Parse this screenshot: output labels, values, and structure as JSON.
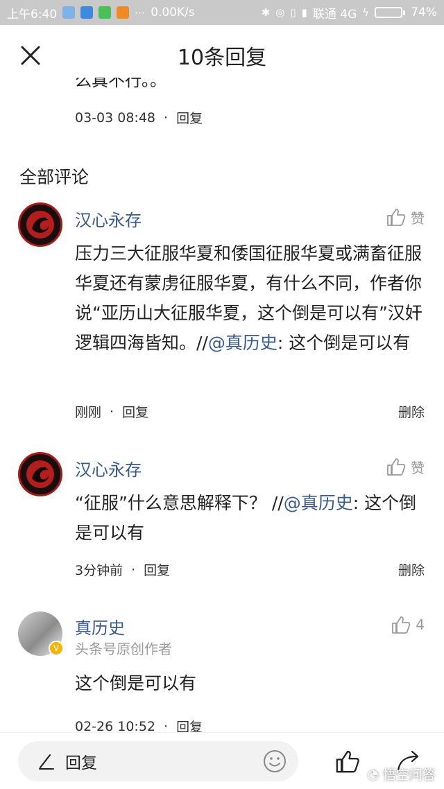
{
  "status_bar": {
    "time": "上午6:40",
    "network_speed": "0.00K/s",
    "carrier": "联通 4G",
    "battery": "74%",
    "battery_level": 0.74
  },
  "header": {
    "title": "10条回复"
  },
  "previous_reply": {
    "clipped_text": "么真不行。。",
    "time": "03-03 08:48",
    "reply_label": "回复"
  },
  "section": {
    "title": "全部评论"
  },
  "comments": [
    {
      "user": "汉心永存",
      "like_label": "赞",
      "text_before_mention": "压力三大征服华夏和倭国征服华夏或满畜征服华夏还有蒙虏征服华夏，有什么不同，作者你说“亚历山大征服华夏，这个倒是可以有”汉奸逻辑四海皆知。//",
      "mention": "@真历史",
      "text_after_mention": ": 这个倒是可以有",
      "time": "刚刚",
      "reply_label": "回复",
      "delete_label": "删除"
    },
    {
      "user": "汉心永存",
      "like_label": "赞",
      "text_before_mention": "“征服”什么意思解释下？ //",
      "mention": "@真历史",
      "text_after_mention": ": 这个倒是可以有",
      "time": "3分钟前",
      "reply_label": "回复",
      "delete_label": "删除"
    },
    {
      "user": "真历史",
      "subtitle": "头条号原创作者",
      "like_count": "4",
      "text": "这个倒是可以有",
      "time": "02-26 10:52",
      "reply_label": "回复"
    }
  ],
  "bottom_bar": {
    "reply_label": "回复"
  },
  "watermark": {
    "text": "悟空问答"
  },
  "colors": {
    "link": "#3a5a8c",
    "muted": "#999999",
    "status_bar": "#c9c9c9",
    "battery": "#5cd12e",
    "verified": "#f5b400"
  }
}
